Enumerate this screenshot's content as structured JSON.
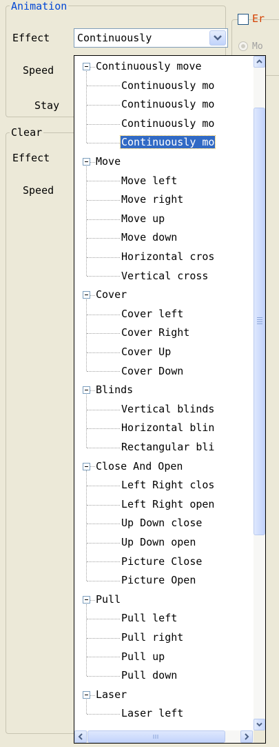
{
  "animation_group": {
    "title": "Animation",
    "effect_label": "Effect",
    "effect_value": "Continuously",
    "speed_label": "Speed",
    "stay_label": "Stay"
  },
  "clear_group": {
    "title": "Clear",
    "effect_label": "Effect",
    "speed_label": "Speed"
  },
  "right_panel": {
    "checkbox_label_partial": "Er",
    "radio_label_partial": "Mo"
  },
  "dropdown_tree": [
    {
      "label": "Continuously move",
      "children": [
        "Continuously mo",
        "Continuously mo",
        "Continuously mo",
        "Continuously mo"
      ],
      "selected_child": 3
    },
    {
      "label": "Move",
      "children": [
        "Move left",
        "Move right",
        "Move up",
        "Move down",
        "Horizontal cros",
        "Vertical cross"
      ]
    },
    {
      "label": "Cover",
      "children": [
        "Cover left",
        "Cover Right",
        "Cover Up",
        "Cover Down"
      ]
    },
    {
      "label": "Blinds",
      "children": [
        "Vertical blinds",
        "Horizontal blin",
        "Rectangular bli"
      ]
    },
    {
      "label": "Close And Open",
      "children": [
        "Left Right clos",
        "Left Right open",
        "Up Down close",
        "Up Down open",
        "Picture Close",
        "Picture Open"
      ]
    },
    {
      "label": "Pull",
      "children": [
        "Pull left",
        "Pull right",
        "Pull up",
        "Pull down"
      ]
    },
    {
      "label": "Laser",
      "children": [
        "Laser left"
      ]
    }
  ],
  "icons": {
    "combo_arrow": "chevron-down-icon",
    "expander": "collapse-minus-icon",
    "scroll_up": "scroll-up-arrow-icon",
    "scroll_down": "scroll-down-arrow-icon",
    "scroll_left": "scroll-left-arrow-icon",
    "scroll_right": "scroll-right-arrow-icon"
  },
  "colors": {
    "group_title": "#0046d5",
    "selection": "#316ac5",
    "accent_checkbox_text": "#d44000"
  }
}
